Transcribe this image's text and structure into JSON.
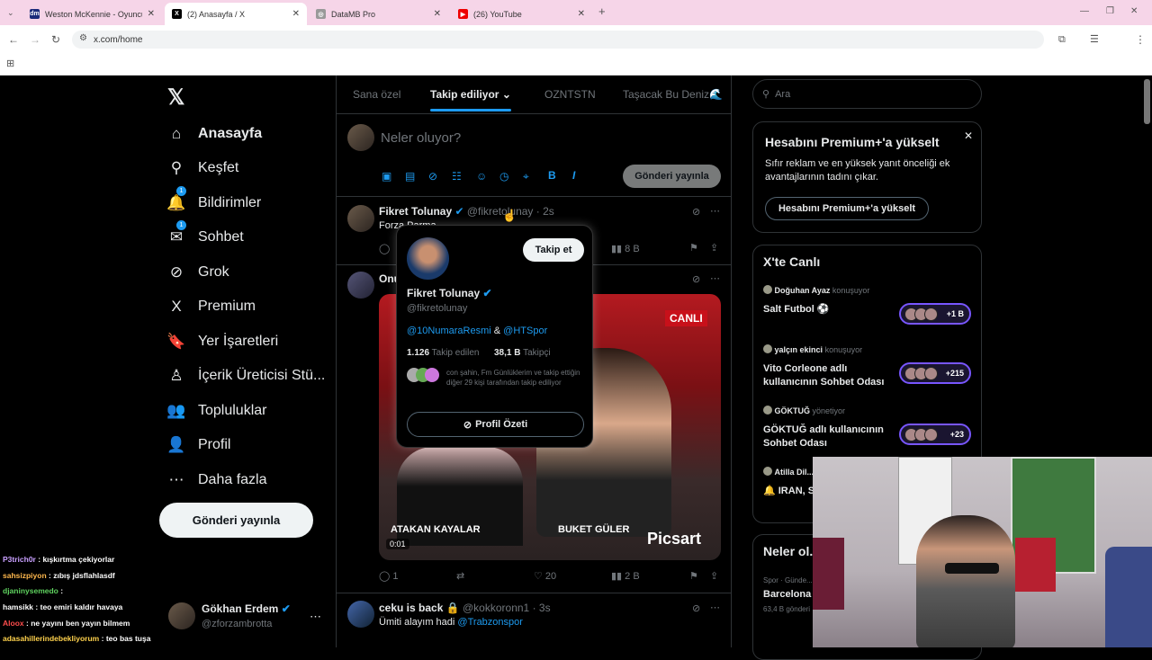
{
  "browser": {
    "tabs": [
      {
        "title": "Weston McKennie - Oyuncu pr...",
        "favicon": "dm"
      },
      {
        "title": "(2) Anasayfa / X",
        "favicon": "X"
      },
      {
        "title": "DataMB Pro",
        "favicon": "◎"
      },
      {
        "title": "(26) YouTube",
        "favicon": "▶"
      }
    ],
    "url": "x.com/home"
  },
  "nav": {
    "items": [
      {
        "label": "Anasayfa",
        "icon": "home-icon",
        "glyph": "⌂"
      },
      {
        "label": "Keşfet",
        "icon": "search-icon",
        "glyph": "⚲"
      },
      {
        "label": "Bildirimler",
        "icon": "bell-icon",
        "glyph": "🔔",
        "badge": "1"
      },
      {
        "label": "Sohbet",
        "icon": "mail-icon",
        "glyph": "✉",
        "badge": "1"
      },
      {
        "label": "Grok",
        "icon": "grok-icon",
        "glyph": "⊘"
      },
      {
        "label": "Premium",
        "icon": "x-logo-icon",
        "glyph": "X"
      },
      {
        "label": "Yer İşaretleri",
        "icon": "bookmark-icon",
        "glyph": "🔖"
      },
      {
        "label": "İçerik Üreticisi Stü...",
        "icon": "creator-icon",
        "glyph": "♙"
      },
      {
        "label": "Topluluklar",
        "icon": "communities-icon",
        "glyph": "👥"
      },
      {
        "label": "Profil",
        "icon": "profile-icon",
        "glyph": "👤"
      },
      {
        "label": "Daha fazla",
        "icon": "more-icon",
        "glyph": "⋯"
      }
    ],
    "post_button": "Gönderi yayınla",
    "account": {
      "name": "Gökhan Erdem",
      "handle": "@zforzambrotta"
    }
  },
  "feed": {
    "tabs": [
      "Sana özel",
      "Takip ediliyor",
      "OZNTSTN",
      "Taşacak Bu Deniz🌊"
    ],
    "compose_placeholder": "Neler oluyor?",
    "compose_button": "Gönderi yayınla",
    "post1": {
      "name": "Fikret Tolunay",
      "handle": "@fikretolunay",
      "time": "· 2s",
      "text": "Forza Parma, ...",
      "views": "8 B"
    },
    "post2": {
      "name": "Onu...",
      "video_left_caption": "ATAKAN KAYALAR",
      "video_right_caption": "BUKET GÜLER",
      "live_badge": "CANLI",
      "watermark": "Picsart",
      "timestamp": "0:01",
      "replies": "1",
      "likes": "20",
      "views": "2 B"
    },
    "post3": {
      "name": "ceku is back 🔒",
      "handle": "@kokkoronn1",
      "time": "· 3s",
      "text_prefix": "Ümiti alayım hadi ",
      "mention": "@Trabzonspor"
    }
  },
  "popup": {
    "follow_button": "Takip et",
    "name": "Fikret Tolunay",
    "handle": "@fikretolunay",
    "bio_mention1": "@10NumaraResmi",
    "bio_and": "&",
    "bio_mention2": "@HTSpor",
    "following_count": "1.126",
    "following_label": "Takip edilen",
    "followers_count": "38,1 B",
    "followers_label": "Takipçi",
    "mutuals": "con şahin, Fm Günlüklerim ve takip ettiğin diğer 29 kişi tarafından takip ediliyor",
    "profile_button": "Profil Özeti"
  },
  "right": {
    "search_placeholder": "Ara",
    "premium_title": "Hesabını Premium+'a yükselt",
    "premium_text": "Sıfır reklam ve en yüksek yanıt önceliği ek avantajlarının tadını çıkar.",
    "premium_button": "Hesabını Premium+'a yükselt",
    "live_title": "X'te Canlı",
    "live_items": [
      {
        "host": "Doğuhan Ayaz",
        "role": "konuşuyor",
        "title": "Salt Futbol ⚽",
        "count": "+1 B"
      },
      {
        "host": "yalçın ekinci",
        "role": "konuşuyor",
        "title": "Vito Corleone adlı kullanıcının Sohbet Odası",
        "count": "+215"
      },
      {
        "host": "GÖKTUĞ",
        "role": "yönetiyor",
        "title": "GÖKTUĞ adlı kullanıcının Sohbet Odası",
        "count": "+23"
      },
      {
        "host": "Atilla Dil...",
        "role": "",
        "title": "🔔 IRAN, S... HALEP'TE",
        "count": ""
      }
    ],
    "news_title": "Neler ol...",
    "news_category": "Spor · Günde...",
    "news_item": "Barcelona",
    "news_count": "63,4 B gönderi"
  },
  "chat": [
    {
      "user": "P3trich0r",
      "msg": "kışkırtma çekiyorlar",
      "color": "#c9a0ff"
    },
    {
      "user": "sahsizpiyon",
      "msg": "zıbış jdsflahlasdf",
      "color": "#ffb84d"
    },
    {
      "user": "djaninysemedo",
      "msg": "",
      "color": "#5fd35f"
    },
    {
      "user": "hamsikk",
      "msg": "teo emiri kaldır havaya",
      "color": "#ffffff"
    },
    {
      "user": "Aloox",
      "msg": "ne yayını ben yayın bilmem",
      "color": "#ff4d4d"
    },
    {
      "user": "adasahillerindebekliyorum",
      "msg": "teo bas tuşa",
      "color": "#ffd24d"
    }
  ],
  "colors": {
    "accent": "#1d9bf0",
    "live": "#7856ff",
    "tab_bar": "#f6d5e8"
  }
}
